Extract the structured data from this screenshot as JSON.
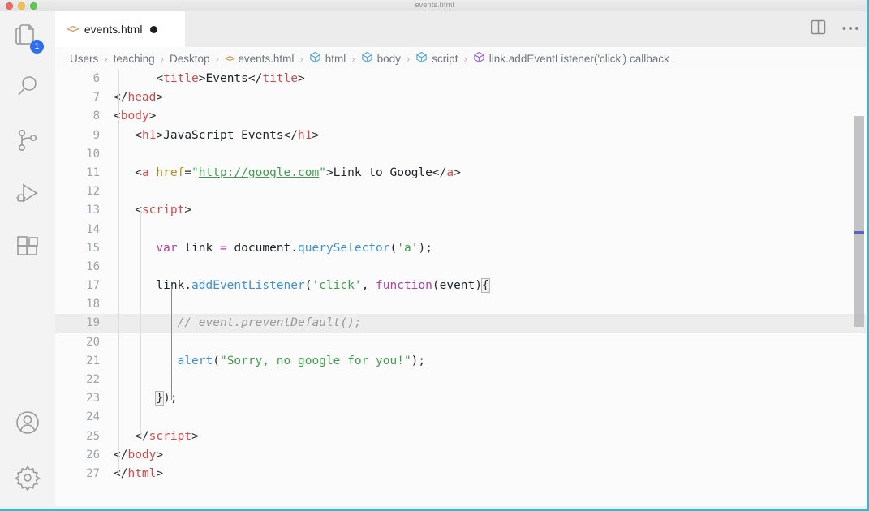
{
  "window": {
    "title": "events.html",
    "traffic_lights": [
      "close",
      "minimize",
      "maximize"
    ]
  },
  "activity_bar": {
    "items": [
      {
        "name": "explorer",
        "icon": "files-icon",
        "badge": "1"
      },
      {
        "name": "search",
        "icon": "search-icon",
        "badge": ""
      },
      {
        "name": "source-control",
        "icon": "source-control-icon",
        "badge": ""
      },
      {
        "name": "run-and-debug",
        "icon": "run-debug-icon",
        "badge": ""
      },
      {
        "name": "extensions",
        "icon": "extensions-icon",
        "badge": ""
      },
      {
        "name": "accounts",
        "icon": "account-icon",
        "badge": ""
      },
      {
        "name": "settings",
        "icon": "gear-icon",
        "badge": ""
      }
    ]
  },
  "tab": {
    "icon": "<>",
    "label": "events.html",
    "dirty": true,
    "split_icon": "split-editor-icon",
    "more_icon": "•••"
  },
  "breadcrumb": {
    "segments": [
      {
        "icon": "",
        "label": "Users"
      },
      {
        "icon": "",
        "label": "teaching"
      },
      {
        "icon": "",
        "label": "Desktop"
      },
      {
        "icon": "code",
        "label": "events.html"
      },
      {
        "icon": "symbol-blue",
        "label": "html"
      },
      {
        "icon": "symbol-blue",
        "label": "body"
      },
      {
        "icon": "symbol-blue",
        "label": "script"
      },
      {
        "icon": "symbol-purple",
        "label": "link.addEventListener('click') callback"
      }
    ],
    "separator": "›"
  },
  "editor": {
    "language": "html",
    "first_visible_line": 6,
    "active_line": 19,
    "lines": [
      {
        "n": "6",
        "tokens": [
          {
            "t": "plain",
            "v": "      "
          },
          {
            "t": "punct",
            "v": "<"
          },
          {
            "t": "tag",
            "v": "title"
          },
          {
            "t": "punct",
            "v": ">"
          },
          {
            "t": "plain",
            "v": "Events"
          },
          {
            "t": "punct",
            "v": "</"
          },
          {
            "t": "tag",
            "v": "title"
          },
          {
            "t": "punct",
            "v": ">"
          }
        ]
      },
      {
        "n": "7",
        "tokens": [
          {
            "t": "punct",
            "v": "</"
          },
          {
            "t": "tag",
            "v": "head"
          },
          {
            "t": "punct",
            "v": ">"
          }
        ]
      },
      {
        "n": "8",
        "tokens": [
          {
            "t": "punct",
            "v": "<"
          },
          {
            "t": "tag",
            "v": "body"
          },
          {
            "t": "punct",
            "v": ">"
          }
        ]
      },
      {
        "n": "9",
        "tokens": [
          {
            "t": "plain",
            "v": "   "
          },
          {
            "t": "punct",
            "v": "<"
          },
          {
            "t": "tag",
            "v": "h1"
          },
          {
            "t": "punct",
            "v": ">"
          },
          {
            "t": "plain",
            "v": "JavaScript Events"
          },
          {
            "t": "punct",
            "v": "</"
          },
          {
            "t": "tag",
            "v": "h1"
          },
          {
            "t": "punct",
            "v": ">"
          }
        ]
      },
      {
        "n": "10",
        "tokens": []
      },
      {
        "n": "11",
        "tokens": [
          {
            "t": "plain",
            "v": "   "
          },
          {
            "t": "punct",
            "v": "<"
          },
          {
            "t": "tag",
            "v": "a"
          },
          {
            "t": "plain",
            "v": " "
          },
          {
            "t": "attr",
            "v": "href"
          },
          {
            "t": "punct",
            "v": "="
          },
          {
            "t": "str",
            "v": "\""
          },
          {
            "t": "link",
            "v": "http://google.com"
          },
          {
            "t": "str",
            "v": "\""
          },
          {
            "t": "punct",
            "v": ">"
          },
          {
            "t": "plain",
            "v": "Link to Google"
          },
          {
            "t": "punct",
            "v": "</"
          },
          {
            "t": "tag",
            "v": "a"
          },
          {
            "t": "punct",
            "v": ">"
          }
        ]
      },
      {
        "n": "12",
        "tokens": []
      },
      {
        "n": "13",
        "tokens": [
          {
            "t": "plain",
            "v": "   "
          },
          {
            "t": "punct",
            "v": "<"
          },
          {
            "t": "tag",
            "v": "script"
          },
          {
            "t": "punct",
            "v": ">"
          }
        ]
      },
      {
        "n": "14",
        "tokens": []
      },
      {
        "n": "15",
        "tokens": [
          {
            "t": "plain",
            "v": "      "
          },
          {
            "t": "kw",
            "v": "var"
          },
          {
            "t": "plain",
            "v": " link "
          },
          {
            "t": "kw",
            "v": "="
          },
          {
            "t": "plain",
            "v": " document."
          },
          {
            "t": "fn",
            "v": "querySelector"
          },
          {
            "t": "punct",
            "v": "("
          },
          {
            "t": "str",
            "v": "'a'"
          },
          {
            "t": "punct",
            "v": ");"
          }
        ]
      },
      {
        "n": "16",
        "tokens": []
      },
      {
        "n": "17",
        "tokens": [
          {
            "t": "plain",
            "v": "      link."
          },
          {
            "t": "fn",
            "v": "addEventListener"
          },
          {
            "t": "punct",
            "v": "("
          },
          {
            "t": "str",
            "v": "'click'"
          },
          {
            "t": "punct",
            "v": ", "
          },
          {
            "t": "kw",
            "v": "function"
          },
          {
            "t": "punct",
            "v": "("
          },
          {
            "t": "plain",
            "v": "event"
          },
          {
            "t": "punct",
            "v": ")"
          },
          {
            "t": "bracket",
            "v": "{"
          }
        ]
      },
      {
        "n": "18",
        "tokens": []
      },
      {
        "n": "19",
        "tokens": [
          {
            "t": "plain",
            "v": "         "
          },
          {
            "t": "comment",
            "v": "// event.preventDefault();"
          }
        ]
      },
      {
        "n": "20",
        "tokens": []
      },
      {
        "n": "21",
        "tokens": [
          {
            "t": "plain",
            "v": "         "
          },
          {
            "t": "fn",
            "v": "alert"
          },
          {
            "t": "punct",
            "v": "("
          },
          {
            "t": "str",
            "v": "\"Sorry, no google for you!\""
          },
          {
            "t": "punct",
            "v": ");"
          }
        ]
      },
      {
        "n": "22",
        "tokens": []
      },
      {
        "n": "23",
        "tokens": [
          {
            "t": "plain",
            "v": "      "
          },
          {
            "t": "bracket",
            "v": "}"
          },
          {
            "t": "punct",
            "v": ");"
          }
        ]
      },
      {
        "n": "24",
        "tokens": []
      },
      {
        "n": "25",
        "tokens": [
          {
            "t": "plain",
            "v": "   "
          },
          {
            "t": "punct",
            "v": "</"
          },
          {
            "t": "tag",
            "v": "script"
          },
          {
            "t": "punct",
            "v": ">"
          }
        ]
      },
      {
        "n": "26",
        "tokens": [
          {
            "t": "punct",
            "v": "</"
          },
          {
            "t": "tag",
            "v": "body"
          },
          {
            "t": "punct",
            "v": ">"
          }
        ]
      },
      {
        "n": "27",
        "tokens": [
          {
            "t": "punct",
            "v": "</"
          },
          {
            "t": "tag",
            "v": "html"
          },
          {
            "t": "punct",
            "v": ">"
          }
        ]
      }
    ]
  },
  "colors": {
    "accent_badge": "#2f6ef0",
    "tag": "#d24b4b",
    "string": "#3f9e4d",
    "keyword": "#b4419e",
    "function": "#3f8ede",
    "attribute": "#b58b2a",
    "comment": "#9a9a9a",
    "window_edge": "#3fb6c8",
    "overview_marker": "#5f5fd0"
  }
}
